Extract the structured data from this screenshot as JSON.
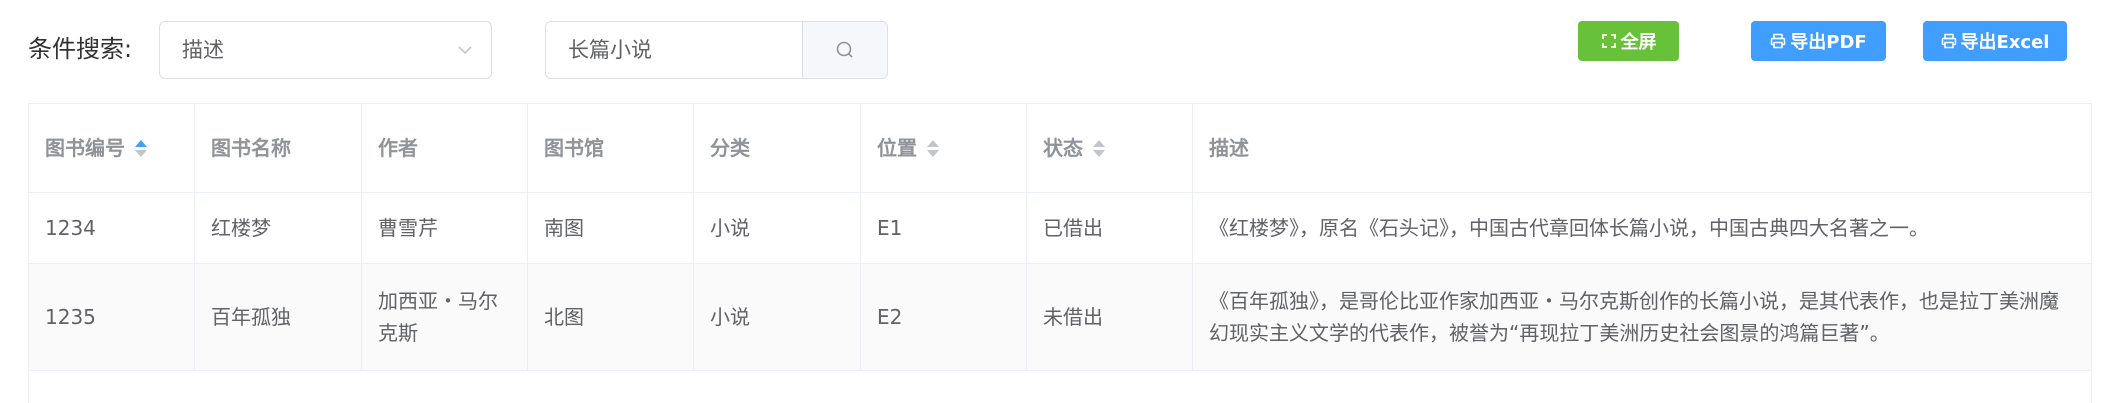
{
  "toolbar": {
    "condition_label": "条件搜索:",
    "field_select_value": "描述",
    "search_value": "长篇小说",
    "fullscreen_label": "全屏",
    "export_pdf_label": "导出PDF",
    "export_excel_label": "导出Excel"
  },
  "colors": {
    "green": "#67c23a",
    "blue": "#409eff",
    "sort_active": "#409eff"
  },
  "icons": {
    "select_chevron": "chevron-down-icon",
    "search": "search-icon",
    "fullscreen": "fullscreen-icon",
    "print": "print-icon"
  },
  "table": {
    "columns": [
      "图书编号",
      "图书名称",
      "作者",
      "图书馆",
      "分类",
      "位置",
      "状态",
      "描述"
    ],
    "rows": [
      [
        "1234",
        "红楼梦",
        "曹雪芹",
        "南图",
        "小说",
        "E1",
        "已借出",
        "《红楼梦》，原名《石头记》，中国古代章回体长篇小说，中国古典四大名著之一。"
      ],
      [
        "1235",
        "百年孤独",
        "加西亚・马尔克斯",
        "北图",
        "小说",
        "E2",
        "未借出",
        "《百年孤独》，是哥伦比亚作家加西亚・马尔克斯创作的长篇小说，是其代表作，也是拉丁美洲魔幻现实主义文学的代表作，被誉为“再现拉丁美洲历史社会图景的鸿篇巨著”。"
      ]
    ]
  }
}
